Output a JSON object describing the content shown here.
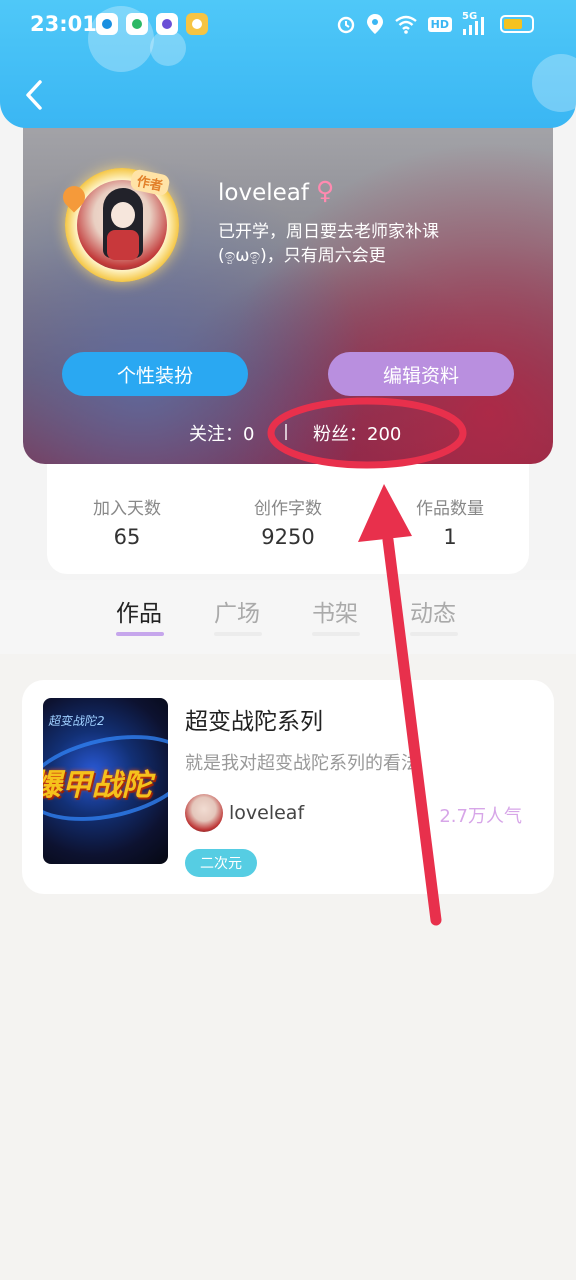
{
  "status_bar": {
    "time": "23:01",
    "app_icons": [
      "app-icon-1",
      "app-icon-2",
      "app-icon-3",
      "app-icon-4"
    ],
    "hd_label": "HD",
    "network_label": "5G"
  },
  "profile": {
    "author_tag": "作者",
    "username": "loveleaf",
    "gender_symbol": "♀",
    "bio_line1": "已开学，周日要去老师家补课",
    "bio_line2": "(ඉωඉ)，只有周六会更",
    "dress_button": "个性装扮",
    "edit_button": "编辑资料",
    "follow_text": "关注：0",
    "fans_text": "粉丝：200"
  },
  "stats": [
    {
      "label": "加入天数",
      "value": "65"
    },
    {
      "label": "创作字数",
      "value": "9250"
    },
    {
      "label": "作品数量",
      "value": "1"
    }
  ],
  "tabs": [
    {
      "label": "作品",
      "active": true
    },
    {
      "label": "广场",
      "active": false
    },
    {
      "label": "书架",
      "active": false
    },
    {
      "label": "动态",
      "active": false
    }
  ],
  "work": {
    "cover_subtitle": "超变战陀2",
    "cover_title": "爆甲战陀",
    "title": "超变战陀系列",
    "description": "就是我对超变战陀系列的看法",
    "author": "loveleaf",
    "popularity": "2.7万人气",
    "genre_tag": "二次元"
  },
  "colors": {
    "header_blue": "#3ab6f3",
    "dress_button": "#2aa8f2",
    "edit_button": "#b98fdf",
    "tab_underline": "#c6a6ec",
    "genre_tag": "#56cde3",
    "popularity": "#d7a6e8",
    "annotation_red": "#e8304c"
  }
}
